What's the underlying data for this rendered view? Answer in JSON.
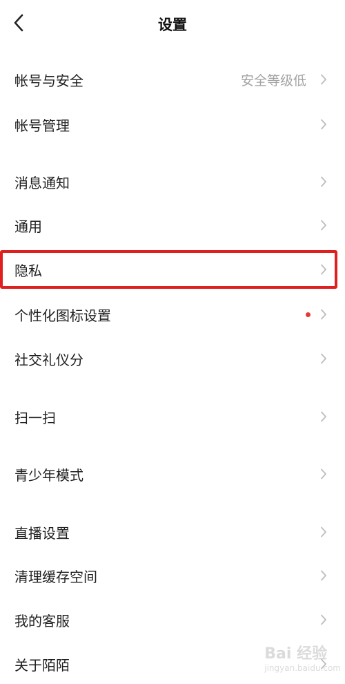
{
  "header": {
    "title": "设置",
    "back_icon": "chevron-left-icon"
  },
  "items": [
    {
      "label": "帐号与安全",
      "value": "安全等级低"
    },
    {
      "label": "帐号管理"
    },
    {
      "label": "消息通知"
    },
    {
      "label": "通用"
    },
    {
      "label": "隐私",
      "highlighted": true
    },
    {
      "label": "个性化图标设置",
      "badge": "red-dot"
    },
    {
      "label": "社交礼仪分"
    },
    {
      "label": "扫一扫"
    },
    {
      "label": "青少年模式"
    },
    {
      "label": "直播设置"
    },
    {
      "label": "清理缓存空间"
    },
    {
      "label": "我的客服"
    },
    {
      "label": "关于陌陌"
    }
  ],
  "watermark": {
    "text": "Bai 经验",
    "sub": "jingyan.baidu.com"
  },
  "colors": {
    "background": "#ffffff",
    "text": "#1f1f1f",
    "secondary_text": "#a3a3a3",
    "chevron": "#bdbdbd",
    "highlight": "#e0201f",
    "badge": "#e53935"
  }
}
